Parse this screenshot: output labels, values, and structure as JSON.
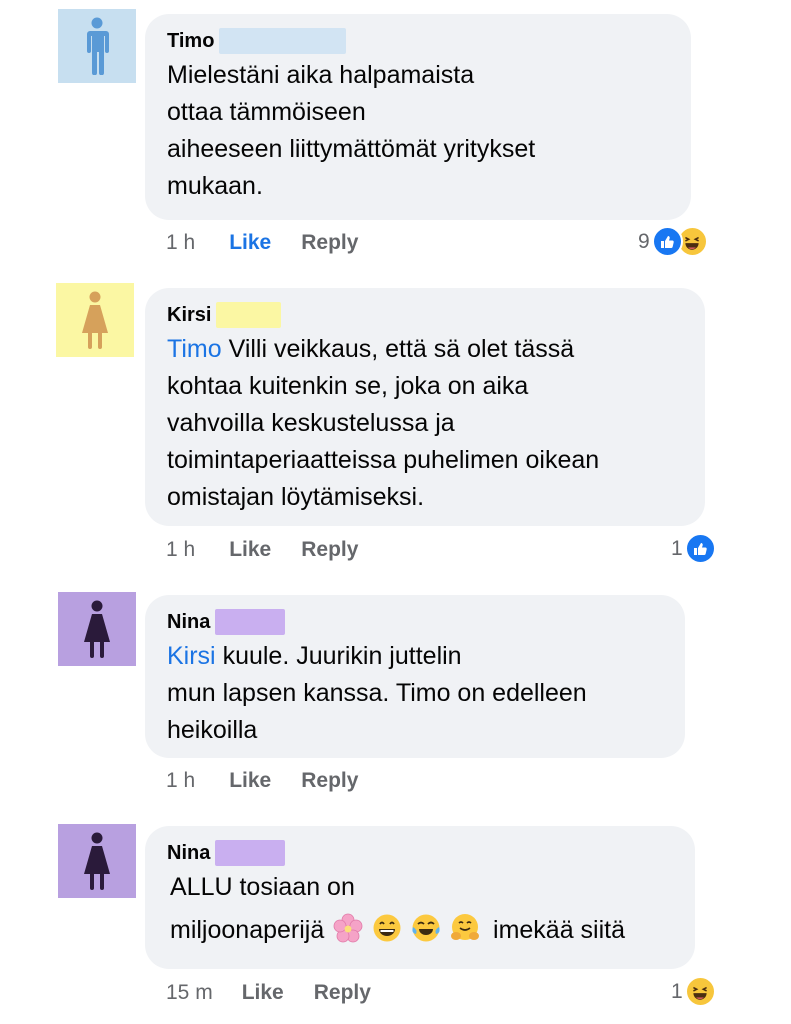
{
  "colors": {
    "bubble": "#f0f2f5",
    "mention": "#1b74e4",
    "like_active": "#1b74e4",
    "meta": "#65676b",
    "avatar_blue_bg": "#c7dff0",
    "avatar_blue_fg": "#5a9ad6",
    "avatar_yellow_bg": "#fbf7a3",
    "avatar_yellow_fg": "#d6a15b",
    "avatar_purple_bg": "#b8a0e0",
    "avatar_purple_fg": "#2a1a3a"
  },
  "comments": [
    {
      "author": "Timo",
      "avatar": "man-icon",
      "mention": "",
      "lines": [
        "Mielestäni aika halpamaista",
        "ottaa tämmöiseen",
        "aiheeseen liittymättömät yritykset",
        "mukaan."
      ],
      "time": "1 h",
      "like_label": "Like",
      "reply_label": "Reply",
      "reaction_count": "9",
      "reactions": [
        "thumbs-up-icon",
        "laughing-icon"
      ]
    },
    {
      "author": "Kirsi",
      "avatar": "woman-icon",
      "mention": "Timo",
      "lines": [
        "Villi veikkaus, että sä olet tässä",
        "kohtaa kuitenkin se, joka on aika",
        "vahvoilla keskustelussa ja",
        "toimintaperiaatteissa puhelimen oikean",
        "omistajan löytämiseksi."
      ],
      "time": "1 h",
      "like_label": "Like",
      "reply_label": "Reply",
      "reaction_count": "1",
      "reactions": [
        "thumbs-up-icon"
      ]
    },
    {
      "author": "Nina",
      "avatar": "woman-icon",
      "mention": "Kirsi",
      "lines": [
        "kuule. Juurikin juttelin",
        "mun lapsen kanssa. Timo on edelleen",
        "heikoilla"
      ],
      "time": "1 h",
      "like_label": "Like",
      "reply_label": "Reply",
      "reaction_count": "",
      "reactions": []
    },
    {
      "author": "Nina",
      "avatar": "woman-icon",
      "mention": "",
      "lines": [
        "ALLU tosiaan on",
        "miljoonaperijä",
        "imekää siitä"
      ],
      "emojis": [
        "cherry-blossom-icon",
        "grinning-face-icon",
        "tears-of-joy-icon",
        "hugging-face-icon"
      ],
      "time": "15 m",
      "like_label": "Like",
      "reply_label": "Reply",
      "reaction_count": "1",
      "reactions": [
        "laughing-icon"
      ]
    }
  ]
}
